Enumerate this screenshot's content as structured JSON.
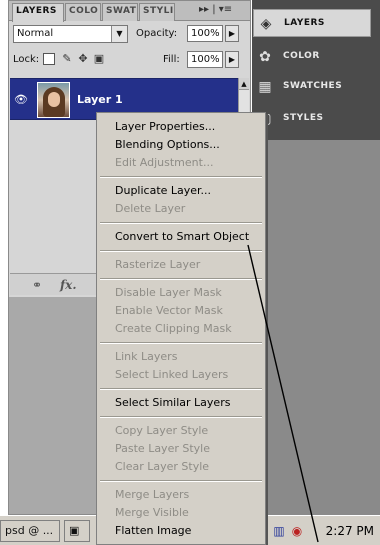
{
  "layers_panel": {
    "tabs": [
      {
        "label": "LAYERS",
        "active": true
      },
      {
        "label": "COLO",
        "active": false
      },
      {
        "label": "SWAT",
        "active": false
      },
      {
        "label": "STYLI",
        "active": false
      }
    ],
    "tab_menu_glyphs": "▸▸ | ▾≡",
    "blend_mode": "Normal",
    "opacity_label": "Opacity:",
    "opacity_value": "100%",
    "lock_label": "Lock:",
    "fill_label": "Fill:",
    "fill_value": "100%",
    "layer": {
      "name": "Layer 1",
      "visible_icon": "eye-icon"
    },
    "bottom_icons": [
      "link-icon",
      "fx-icon"
    ],
    "fx_text": "fx."
  },
  "dock": {
    "items": [
      {
        "label": "LAYERS",
        "icon": "layers-icon",
        "active": true
      },
      {
        "label": "COLOR",
        "icon": "color-icon",
        "active": false
      },
      {
        "label": "SWATCHES",
        "icon": "swatches-icon",
        "active": false
      },
      {
        "label": "STYLES",
        "icon": "styles-icon",
        "active": false
      }
    ]
  },
  "context_menu": {
    "groups": [
      [
        {
          "label": "Layer Properties...",
          "enabled": true
        },
        {
          "label": "Blending Options...",
          "enabled": true
        },
        {
          "label": "Edit Adjustment...",
          "enabled": false
        }
      ],
      [
        {
          "label": "Duplicate Layer...",
          "enabled": true
        },
        {
          "label": "Delete Layer",
          "enabled": false
        }
      ],
      [
        {
          "label": "Convert to Smart Object",
          "enabled": true
        }
      ],
      [
        {
          "label": "Rasterize Layer",
          "enabled": false
        }
      ],
      [
        {
          "label": "Disable Layer Mask",
          "enabled": false
        },
        {
          "label": "Enable Vector Mask",
          "enabled": false
        },
        {
          "label": "Create Clipping Mask",
          "enabled": false
        }
      ],
      [
        {
          "label": "Link Layers",
          "enabled": false
        },
        {
          "label": "Select Linked Layers",
          "enabled": false
        }
      ],
      [
        {
          "label": "Select Similar Layers",
          "enabled": true
        }
      ],
      [
        {
          "label": "Copy Layer Style",
          "enabled": false
        },
        {
          "label": "Paste Layer Style",
          "enabled": false
        },
        {
          "label": "Clear Layer Style",
          "enabled": false
        }
      ],
      [
        {
          "label": "Merge Layers",
          "enabled": false
        },
        {
          "label": "Merge Visible",
          "enabled": false
        },
        {
          "label": "Flatten Image",
          "enabled": true
        }
      ]
    ]
  },
  "taskbar": {
    "task_label": "psd @ ...",
    "clock": "2:27 PM"
  },
  "colors": {
    "selected_layer": "#24308a",
    "menu_bg": "#d4d0c8",
    "disabled_text": "#8e8c86"
  }
}
